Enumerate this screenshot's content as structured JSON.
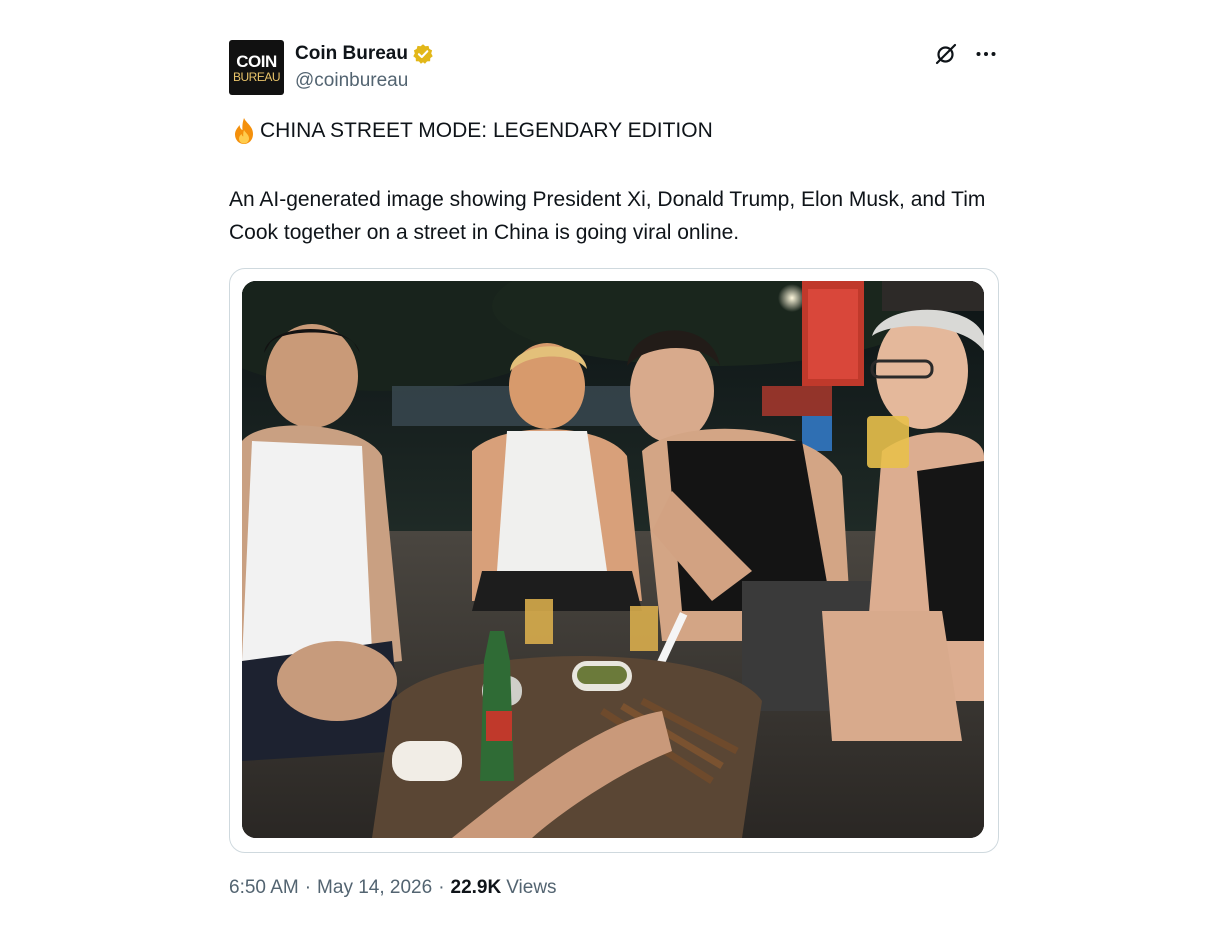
{
  "author": {
    "avatar_line1": "COIN",
    "avatar_line2": "BUREAU",
    "display_name": "Coin Bureau",
    "handle": "@coinbureau",
    "verified_color": "#e2b719"
  },
  "tweet": {
    "headline_icon": "fire-icon",
    "headline": "CHINA STREET MODE: LEGENDARY EDITION",
    "body": "An AI-generated image showing President Xi, Donald Trump, Elon Musk, and Tim Cook together on a street in China is going viral online."
  },
  "meta": {
    "time": "6:50 AM",
    "date": "May 14, 2026",
    "views_count": "22.9K",
    "views_label": "Views",
    "separator": "·"
  },
  "icons": {
    "grok": "grok-icon",
    "more": "more-icon",
    "verified": "verified-badge-icon"
  },
  "colors": {
    "text_primary": "#0f1419",
    "text_secondary": "#536471",
    "border": "#cfd9de"
  }
}
